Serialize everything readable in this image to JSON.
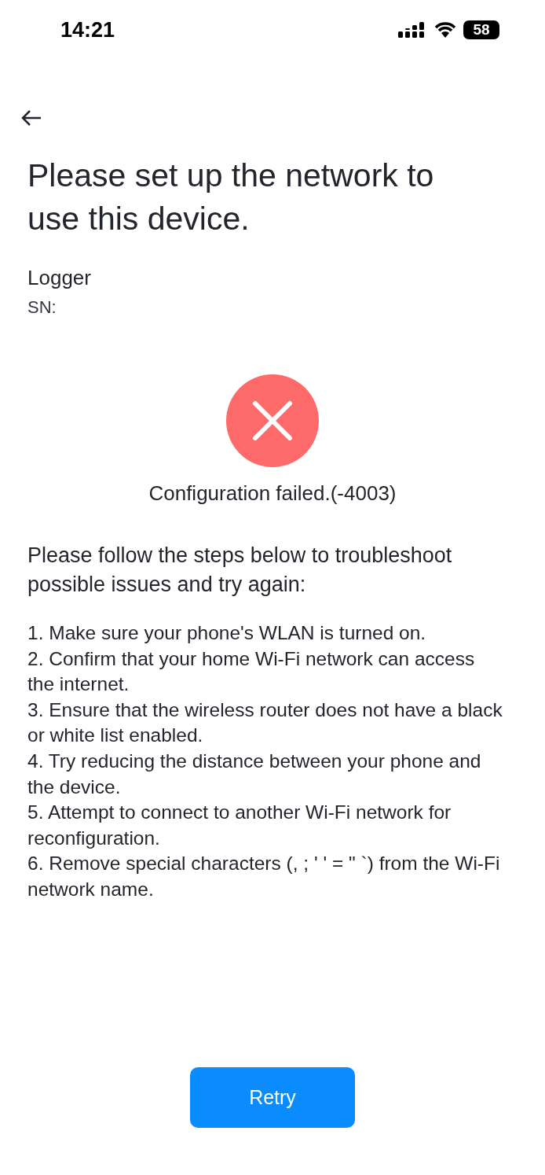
{
  "status_bar": {
    "time": "14:21",
    "battery": "58"
  },
  "title": "Please set up the network to use this device.",
  "device": {
    "name": "Logger",
    "serial_label": "SN:"
  },
  "result": {
    "failed": true,
    "message": "Configuration failed.(-4003)"
  },
  "intro": "Please follow the steps below to troubleshoot possible issues and try again:",
  "steps": [
    "1. Make sure your phone's WLAN is turned on.",
    "2. Confirm that your home Wi-Fi network can access the internet.",
    "3. Ensure that the wireless router does not have a black or white list enabled.",
    "4. Try reducing the distance between your phone and the device.",
    "5. Attempt to connect to another Wi-Fi network for reconfiguration.",
    "6. Remove special characters (, ; ' ' = \" `) from the Wi-Fi network name."
  ],
  "button": "Retry"
}
